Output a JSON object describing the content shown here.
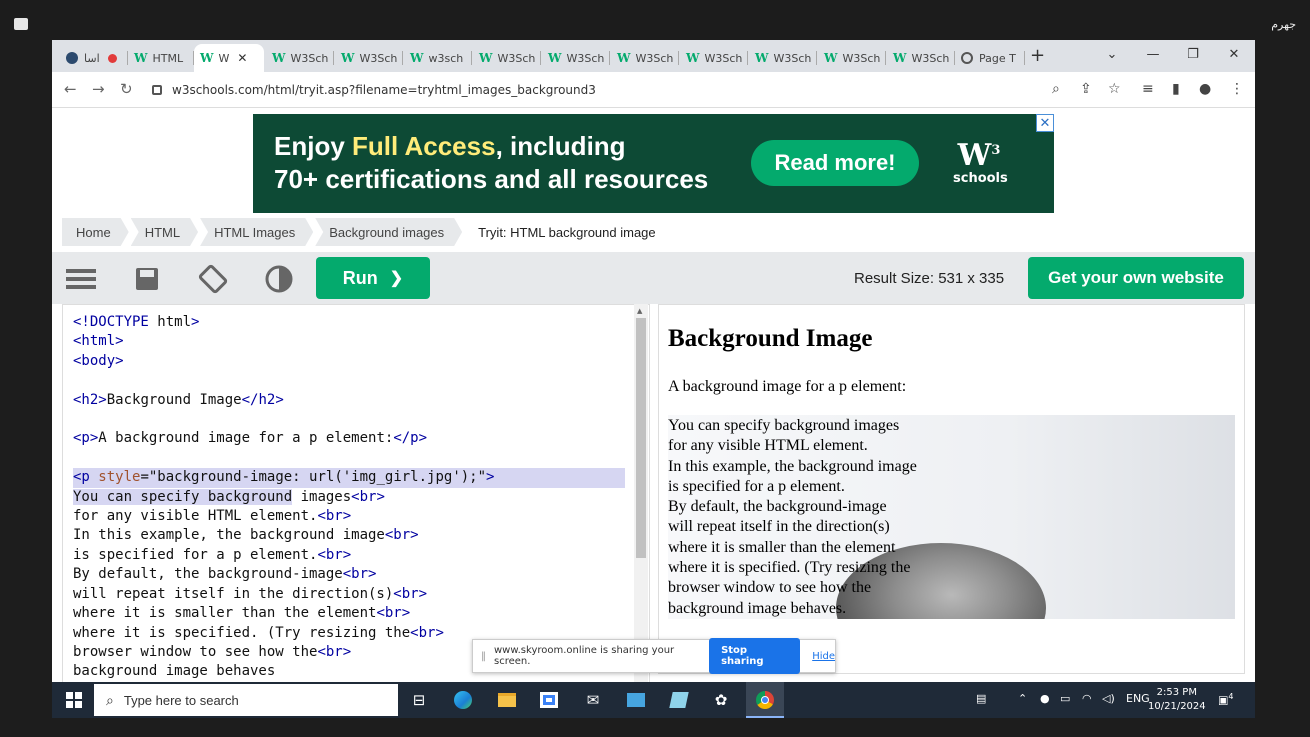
{
  "outer": {
    "rtl_label": "جهرم"
  },
  "tabs": [
    {
      "label": "اسا",
      "icon": "globe-icon"
    },
    {
      "label": "HTML",
      "icon": "w3-icon"
    },
    {
      "label": "W",
      "icon": "w3-icon",
      "active": true
    },
    {
      "label": "W3Sch",
      "icon": "w3-icon"
    },
    {
      "label": "W3Sch",
      "icon": "w3-icon"
    },
    {
      "label": "w3sch",
      "icon": "w3-icon"
    },
    {
      "label": "W3Sch",
      "icon": "w3-icon"
    },
    {
      "label": "W3Sch",
      "icon": "w3-icon"
    },
    {
      "label": "W3Sch",
      "icon": "w3-icon"
    },
    {
      "label": "W3Sch",
      "icon": "w3-icon"
    },
    {
      "label": "W3Sch",
      "icon": "w3-icon"
    },
    {
      "label": "W3Sch",
      "icon": "w3-icon"
    },
    {
      "label": "W3Sch",
      "icon": "w3-icon"
    },
    {
      "label": "Page T",
      "icon": "globe-icon"
    }
  ],
  "browser": {
    "url": "w3schools.com/html/tryit.asp?filename=tryhtml_images_background3",
    "new_tab": "+",
    "tab_close": "✕"
  },
  "ad": {
    "line1_a": "Enjoy ",
    "line1_b": "Full Access",
    "line1_c": ", including",
    "line2": "70+ certifications and all resources",
    "button": "Read more!",
    "logo_big": "W",
    "logo_sup": "3",
    "logo_small": "schools",
    "close": "✕"
  },
  "breadcrumb": [
    "Home",
    "HTML",
    "HTML Images",
    "Background images",
    "Tryit: HTML background image"
  ],
  "editor": {
    "run_label": "Run",
    "run_arrow": "❯",
    "result_size": "Result Size: 531 x 335",
    "own_website": "Get your own website"
  },
  "code_lines": [
    "<!DOCTYPE html>",
    "<html>",
    "<body>",
    "",
    "<h2>Background Image</h2>",
    "",
    "<p>A background image for a p element:</p>",
    "",
    "<p style=\"background-image: url('img_girl.jpg');\">",
    "You can specify background images<br>",
    "for any visible HTML element.<br>",
    "In this example, the background image<br>",
    "is specified for a p element.<br>",
    "By default, the background-image<br>",
    "will repeat itself in the direction(s)<br>",
    "where it is smaller than the element<br>",
    "where it is specified. (Try resizing the<br>",
    "browser window to see how the<br>",
    "background image behaves"
  ],
  "result": {
    "heading": "Background Image",
    "intro": "A background image for a p element:",
    "lines": [
      "You can specify background images",
      "for any visible HTML element.",
      "In this example, the background image",
      "is specified for a p element.",
      "By default, the background-image",
      "will repeat itself in the direction(s)",
      "where it is smaller than the element",
      "where it is specified. (Try resizing the",
      "browser window to see how the",
      "background image behaves."
    ]
  },
  "share": {
    "message": "www.skyroom.online is sharing your screen.",
    "stop": "Stop sharing",
    "hide": "Hide"
  },
  "taskbar": {
    "search_placeholder": "Type here to search",
    "lang": "ENG",
    "time": "2:53 PM",
    "date": "10/21/2024",
    "notif_count": "4"
  },
  "colors": {
    "brand_green": "#04aa6d",
    "ad_bg": "#0d4a35",
    "highlight": "#ffec7a"
  }
}
